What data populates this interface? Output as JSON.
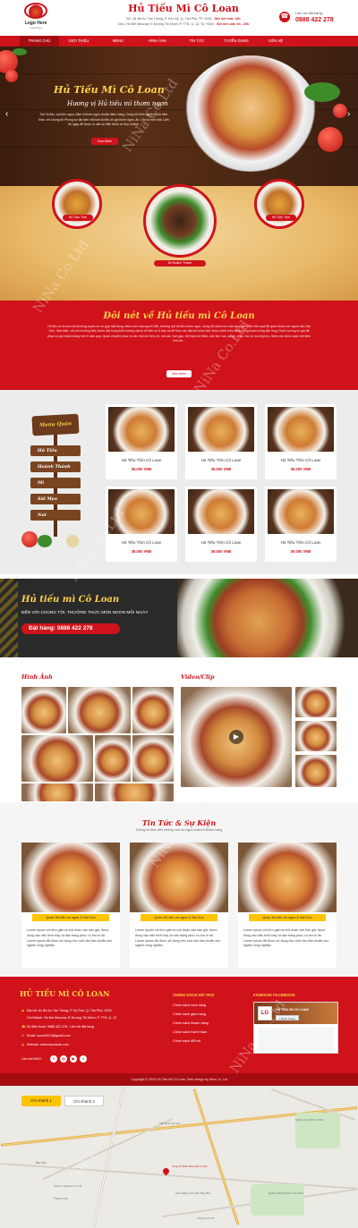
{
  "header": {
    "logo_text": "Logo Here",
    "logo_sub": "restaurant",
    "title": "Hủ Tiếu Mì Cô Loan",
    "addr1": "ĐC: 81 Bờ Ao Tân Thông, P. Sơn Kỳ, Q. Tân Phú, TP. HCM",
    "addr1_hours": "Giờ mở cửa: 24h",
    "addr2": "CN1: Hồ Bơi Moscow, Đ Dương Thị Mười, P. TTN, Q. 12, Tp. HCM",
    "addr2_hours": "Giờ mở cửa: 6h - 20h",
    "hotline_label": "Liên hệ đặt hàng:",
    "hotline": "0888 422 278"
  },
  "nav": [
    "Trang chủ",
    "Giới thiệu",
    "Menu",
    "Hình ảnh",
    "Tin tức",
    "Tuyển dụng",
    "Liên hệ"
  ],
  "hero": {
    "title": "Hủ Tiếu Mì Cô Loan",
    "subtitle": "Hương vị Hủ tiếu mì thơm ngon",
    "desc": "Sợi hủ tiếu, sợi bún ngon, đậm vị thơm ngon chuẩn Nam Vang. Cùng với kinh nghiệm của hiện thân, với chúng tôi Phụng sự tận tâm mỗi bát hủ tiếu mì giá thơm ngon, ăn 1 lần là nhớ mãi. Liên hệ ngay để được tư vấn và hiểu thêm về thực khách.",
    "button": "Xem thêm"
  },
  "circles": [
    "Hủ Tiếu Tôm",
    "Mì Hoành Thánh",
    "Hủ Tiếu Tôm"
  ],
  "features": {
    "title": "Đôi nét về Hủ tiếu mì Cô Loan",
    "desc": "Hủ tiếu mì là món ăn thường xuyên có sự góp mặt trong mâm cơm của người Việt, thường bát hủ tiếu thơm ngon, nóng hổi dành cho một ngày làm việc hiệu quả đã quen thuộc với người dân Sài Gòn. Giai thiệt, chỉ còn thường hiệu được đặt trong thiết hương của tô hủ tiếu mì ở bàn cả để thực các đặt hơi khác biệt, khoa chính hiệu hủ thường khách cũng sẵn lòng. Danh hương mì giá đã phục vụ quí khách hàng hơn 5 năm qua. Quán chuyên phục vụ các món hủ tiếu, mì, sủi cảo, bún gạo, kết hợp nói thêm, cật, tôm nạc, cá bò, phèo, ba rọi, xương heo, thêm vào đó là cách chế biến món ăn...",
    "button": "Xem thêm"
  },
  "menu_board": {
    "title": "Menu Quán",
    "items": [
      "Hủ Tiếu",
      "Hoành Thánh",
      "Mì",
      "Sủi Mẹo",
      "Nui"
    ]
  },
  "products": [
    {
      "name": "Hủ Tiếu Tôm Cô Loan",
      "price": "30.000 VNĐ"
    },
    {
      "name": "Hủ Tiếu Tôm Cô Loan",
      "price": "30.000 VNĐ"
    },
    {
      "name": "Hủ Tiếu Tôm Cô Loan",
      "price": "30.000 VNĐ"
    },
    {
      "name": "Hủ Tiếu Tôm Cô Loan",
      "price": "30.000 VNĐ"
    },
    {
      "name": "Hủ Tiếu Tôm Cô Loan",
      "price": "30.000 VNĐ"
    },
    {
      "name": "Hủ Tiếu Tôm Cô Loan",
      "price": "30.000 VNĐ"
    }
  ],
  "promo": {
    "title": "Hủ tiếu mì Cô Loan",
    "subtitle": "ĐẾN VỚI CHÚNG TÔI, THƯỞNG THỨC MÓN NGON MỖI NGÀY",
    "phone": "Đặt hàng: 0888 422 278"
  },
  "gallery": {
    "images_title": "Hình Ảnh",
    "video_title": "Video/Clip"
  },
  "news": {
    "title": "Tin Tức & Sự Kiện",
    "subtitle": "Chúng tôi đem đến những món ăn ngon nhất tới khách hàng",
    "items": [
      {
        "caption": "Quán Hủ tiếu mì ngon ở Sài Gòn",
        "text": "Lorem ipsum chỉ đơn giản là một đoạn văn bản giả, được dùng vào việc trình bày và dàn trang phục vụ cho in ấn. Lorem ipsum đã được sử dụng như một văn bản chuẩn cho ngành công nghiệp"
      },
      {
        "caption": "Quán Hủ tiếu mì ngon ở Sài Gòn",
        "text": "Lorem ipsum chỉ đơn giản là một đoạn văn bản giả, được dùng vào việc trình bày và dàn trang phục vụ cho in ấn. Lorem ipsum đã được sử dụng như một văn bản chuẩn cho ngành công nghiệp"
      },
      {
        "caption": "Quán Hủ tiếu mì ngon ở Sài Gòn",
        "text": "Lorem ipsum chỉ đơn giản là một đoạn văn bản giả, được dùng vào việc trình bày và dàn trang phục vụ cho in ấn. Lorem ipsum đã được sử dụng như một văn bản chuẩn cho ngành công nghiệp"
      }
    ]
  },
  "footer": {
    "brand": "HỦ TIẾU MÌ CÔ LOAN",
    "addr1": "Địa chỉ: 81 Bờ Ao Tân Thông, P. Kỳ Sơn, Q. Tân Phú, HCM",
    "addr2": "Chi Nhánh: Hồ Bơi Moscow, Đ Dương Thị Mười, P. TTN, Q. 12",
    "phone": "Số điện thoại: 0888 422 278 - Liên hệ đặt hàng",
    "email": "Email: suomi2019@gmail.com",
    "web": "Website: huteumycoloan.com",
    "social_label": "Liên kết MXH:",
    "policy_title": "CHÍNH SÁCH HỖ TRỢ",
    "policies": [
      "Chính sách mua hàng",
      "Chính sách giao hàng",
      "Chính sách khách hàng",
      "Chính sách thanh toán",
      "Chính sách đổi trả"
    ],
    "fanpage_title": "FANPAGE FACEBOOK",
    "fb_name": "HỦ TIẾU MÌ CÔ LOAN",
    "fb_like": "Thích Trang",
    "copyright": "Copyright © 2020 Hủ Tiếu Mì Cô Loan. Web design by Nina Co.,Ltd"
  },
  "map": {
    "tab1": "Chi nhánh 1",
    "tab2": "Chi nhánh 2",
    "place": "Công Ty Bình Mina Hủ Tú Sài",
    "labels": [
      "Tập Hoá Lan Anh",
      "Nghĩa trang Phúc Trình",
      "Bàu Mây",
      "Gas & Logistics Co.,Ltd",
      "Cửa Hàng (CX) Văn Bảy Mai",
      "Công ty cơ khí",
      "Thanh Long",
      "Nghĩa trang Phước Lực Minh"
    ]
  },
  "watermark": "NiNa Co.Ltd",
  "colors": {
    "primary": "#d0121b",
    "accent": "#ffd24a",
    "dark": "#2a2a2a"
  }
}
